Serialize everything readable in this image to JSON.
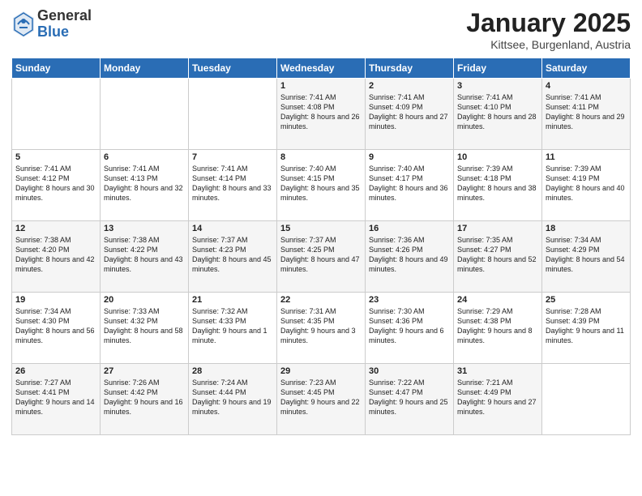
{
  "logo": {
    "general": "General",
    "blue": "Blue"
  },
  "header": {
    "month": "January 2025",
    "location": "Kittsee, Burgenland, Austria"
  },
  "weekdays": [
    "Sunday",
    "Monday",
    "Tuesday",
    "Wednesday",
    "Thursday",
    "Friday",
    "Saturday"
  ],
  "weeks": [
    [
      {
        "day": "",
        "info": ""
      },
      {
        "day": "",
        "info": ""
      },
      {
        "day": "",
        "info": ""
      },
      {
        "day": "1",
        "info": "Sunrise: 7:41 AM\nSunset: 4:08 PM\nDaylight: 8 hours\nand 26 minutes."
      },
      {
        "day": "2",
        "info": "Sunrise: 7:41 AM\nSunset: 4:09 PM\nDaylight: 8 hours\nand 27 minutes."
      },
      {
        "day": "3",
        "info": "Sunrise: 7:41 AM\nSunset: 4:10 PM\nDaylight: 8 hours\nand 28 minutes."
      },
      {
        "day": "4",
        "info": "Sunrise: 7:41 AM\nSunset: 4:11 PM\nDaylight: 8 hours\nand 29 minutes."
      }
    ],
    [
      {
        "day": "5",
        "info": "Sunrise: 7:41 AM\nSunset: 4:12 PM\nDaylight: 8 hours\nand 30 minutes."
      },
      {
        "day": "6",
        "info": "Sunrise: 7:41 AM\nSunset: 4:13 PM\nDaylight: 8 hours\nand 32 minutes."
      },
      {
        "day": "7",
        "info": "Sunrise: 7:41 AM\nSunset: 4:14 PM\nDaylight: 8 hours\nand 33 minutes."
      },
      {
        "day": "8",
        "info": "Sunrise: 7:40 AM\nSunset: 4:15 PM\nDaylight: 8 hours\nand 35 minutes."
      },
      {
        "day": "9",
        "info": "Sunrise: 7:40 AM\nSunset: 4:17 PM\nDaylight: 8 hours\nand 36 minutes."
      },
      {
        "day": "10",
        "info": "Sunrise: 7:39 AM\nSunset: 4:18 PM\nDaylight: 8 hours\nand 38 minutes."
      },
      {
        "day": "11",
        "info": "Sunrise: 7:39 AM\nSunset: 4:19 PM\nDaylight: 8 hours\nand 40 minutes."
      }
    ],
    [
      {
        "day": "12",
        "info": "Sunrise: 7:38 AM\nSunset: 4:20 PM\nDaylight: 8 hours\nand 42 minutes."
      },
      {
        "day": "13",
        "info": "Sunrise: 7:38 AM\nSunset: 4:22 PM\nDaylight: 8 hours\nand 43 minutes."
      },
      {
        "day": "14",
        "info": "Sunrise: 7:37 AM\nSunset: 4:23 PM\nDaylight: 8 hours\nand 45 minutes."
      },
      {
        "day": "15",
        "info": "Sunrise: 7:37 AM\nSunset: 4:25 PM\nDaylight: 8 hours\nand 47 minutes."
      },
      {
        "day": "16",
        "info": "Sunrise: 7:36 AM\nSunset: 4:26 PM\nDaylight: 8 hours\nand 49 minutes."
      },
      {
        "day": "17",
        "info": "Sunrise: 7:35 AM\nSunset: 4:27 PM\nDaylight: 8 hours\nand 52 minutes."
      },
      {
        "day": "18",
        "info": "Sunrise: 7:34 AM\nSunset: 4:29 PM\nDaylight: 8 hours\nand 54 minutes."
      }
    ],
    [
      {
        "day": "19",
        "info": "Sunrise: 7:34 AM\nSunset: 4:30 PM\nDaylight: 8 hours\nand 56 minutes."
      },
      {
        "day": "20",
        "info": "Sunrise: 7:33 AM\nSunset: 4:32 PM\nDaylight: 8 hours\nand 58 minutes."
      },
      {
        "day": "21",
        "info": "Sunrise: 7:32 AM\nSunset: 4:33 PM\nDaylight: 9 hours\nand 1 minute."
      },
      {
        "day": "22",
        "info": "Sunrise: 7:31 AM\nSunset: 4:35 PM\nDaylight: 9 hours\nand 3 minutes."
      },
      {
        "day": "23",
        "info": "Sunrise: 7:30 AM\nSunset: 4:36 PM\nDaylight: 9 hours\nand 6 minutes."
      },
      {
        "day": "24",
        "info": "Sunrise: 7:29 AM\nSunset: 4:38 PM\nDaylight: 9 hours\nand 8 minutes."
      },
      {
        "day": "25",
        "info": "Sunrise: 7:28 AM\nSunset: 4:39 PM\nDaylight: 9 hours\nand 11 minutes."
      }
    ],
    [
      {
        "day": "26",
        "info": "Sunrise: 7:27 AM\nSunset: 4:41 PM\nDaylight: 9 hours\nand 14 minutes."
      },
      {
        "day": "27",
        "info": "Sunrise: 7:26 AM\nSunset: 4:42 PM\nDaylight: 9 hours\nand 16 minutes."
      },
      {
        "day": "28",
        "info": "Sunrise: 7:24 AM\nSunset: 4:44 PM\nDaylight: 9 hours\nand 19 minutes."
      },
      {
        "day": "29",
        "info": "Sunrise: 7:23 AM\nSunset: 4:45 PM\nDaylight: 9 hours\nand 22 minutes."
      },
      {
        "day": "30",
        "info": "Sunrise: 7:22 AM\nSunset: 4:47 PM\nDaylight: 9 hours\nand 25 minutes."
      },
      {
        "day": "31",
        "info": "Sunrise: 7:21 AM\nSunset: 4:49 PM\nDaylight: 9 hours\nand 27 minutes."
      },
      {
        "day": "",
        "info": ""
      }
    ]
  ]
}
